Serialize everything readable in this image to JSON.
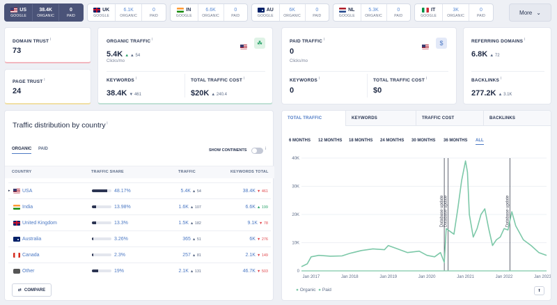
{
  "country_tabs": [
    {
      "code": "US",
      "flag": "f-us",
      "organic": "38.4K",
      "paid": "0",
      "organic_label": "ORGANIC",
      "paid_label": "PAID",
      "engine": "GOOGLE",
      "active": true
    },
    {
      "code": "UK",
      "flag": "f-uk",
      "organic": "6.1K",
      "paid": "0",
      "organic_label": "ORGANIC",
      "paid_label": "PAID",
      "engine": "GOOGLE",
      "active": false
    },
    {
      "code": "IN",
      "flag": "f-in",
      "organic": "6.6K",
      "paid": "0",
      "organic_label": "ORGANIC",
      "paid_label": "PAID",
      "engine": "GOOGLE",
      "active": false
    },
    {
      "code": "AU",
      "flag": "f-au",
      "organic": "6K",
      "paid": "0",
      "organic_label": "ORGANIC",
      "paid_label": "PAID",
      "engine": "GOOGLE",
      "active": false
    },
    {
      "code": "NL",
      "flag": "f-nl",
      "organic": "5.3K",
      "paid": "0",
      "organic_label": "ORGANIC",
      "paid_label": "PAID",
      "engine": "GOOGLE",
      "active": false
    },
    {
      "code": "IT",
      "flag": "f-it",
      "organic": "3K",
      "paid": "0",
      "organic_label": "ORGANIC",
      "paid_label": "PAID",
      "engine": "GOOGLE",
      "active": false
    }
  ],
  "more_label": "More",
  "domain_trust": {
    "label": "DOMAIN TRUST",
    "value": "73"
  },
  "page_trust": {
    "label": "PAGE TRUST",
    "value": "24"
  },
  "organic": {
    "label": "ORGANIC TRAFFIC",
    "value": "5.4K",
    "delta": "▲ 54",
    "unit": "Clicks/mo",
    "kw_label": "KEYWORDS",
    "kw_value": "38.4K",
    "kw_delta": "▼ 461",
    "cost_label": "TOTAL TRAFFIC COST",
    "cost_value": "$20K",
    "cost_delta": "▲ 240.4"
  },
  "paid": {
    "label": "PAID TRAFFIC",
    "value": "0",
    "unit": "Clicks/mo",
    "kw_label": "KEYWORDS",
    "kw_value": "0",
    "cost_label": "TOTAL TRAFFIC COST",
    "cost_value": "$0"
  },
  "referring": {
    "label": "REFERRING DOMAINS",
    "value": "6.8K",
    "delta": "▲ 72",
    "bl_label": "BACKLINKS",
    "bl_value": "277.2K",
    "bl_delta": "▲ 3.1K"
  },
  "distribution": {
    "title": "Traffic distribution by country",
    "tab_organic": "ORGANIC",
    "tab_paid": "PAID",
    "show_continents": "SHOW CONTINENTS",
    "headers": {
      "country": "COUNTRY",
      "share": "TRAFFIC SHARE",
      "traffic": "TRAFFIC",
      "keywords": "KEYWORDS TOTAL"
    },
    "rows": [
      {
        "name": "USA",
        "flag": "f-us",
        "share": "48.17%",
        "pct": 48.17,
        "traffic": "5.4K",
        "t_delta": "▲ 54",
        "t_dir": "up",
        "kw": "38.4K",
        "k_delta": "▼ 461",
        "k_dir": "down"
      },
      {
        "name": "India",
        "flag": "f-in",
        "share": "13.98%",
        "pct": 13.98,
        "traffic": "1.6K",
        "t_delta": "▲ 107",
        "t_dir": "up",
        "kw": "6.6K",
        "k_delta": "▲ 199",
        "k_dir": "up"
      },
      {
        "name": "United Kingdom",
        "flag": "f-uk",
        "share": "13.3%",
        "pct": 13.3,
        "traffic": "1.5K",
        "t_delta": "▲ 182",
        "t_dir": "up",
        "kw": "9.1K",
        "k_delta": "▼ 78",
        "k_dir": "down"
      },
      {
        "name": "Australia",
        "flag": "f-au",
        "share": "3.26%",
        "pct": 3.26,
        "traffic": "365",
        "t_delta": "▲ 51",
        "t_dir": "up",
        "kw": "6K",
        "k_delta": "▼ 276",
        "k_dir": "down"
      },
      {
        "name": "Canada",
        "flag": "f-ca",
        "share": "2.3%",
        "pct": 2.3,
        "traffic": "257",
        "t_delta": "▲ 81",
        "t_dir": "up",
        "kw": "2.1K",
        "k_delta": "▼ 149",
        "k_dir": "down"
      },
      {
        "name": "Other",
        "flag": "f-ot",
        "share": "19%",
        "pct": 19,
        "traffic": "2.1K",
        "t_delta": "▲ 131",
        "t_dir": "up",
        "kw": "46.7K",
        "k_delta": "▼ 503",
        "k_dir": "down"
      }
    ],
    "compare_label": "COMPARE"
  },
  "chart_tabs": [
    "TOTAL TRAFFIC",
    "KEYWORDS",
    "TRAFFIC COST",
    "BACKLINKS"
  ],
  "periods": [
    "6 MONTHS",
    "12 MONTHS",
    "18 MONTHS",
    "24 MONTHS",
    "30 MONTHS",
    "36 MONTHS",
    "ALL"
  ],
  "chart_data": {
    "type": "line",
    "y_ticks": [
      "0",
      "10K",
      "20K",
      "30K",
      "40K"
    ],
    "ylim": [
      0,
      40000
    ],
    "x_ticks": [
      "Jan 2017",
      "Jan 2018",
      "Jan 2019",
      "Jan 2020",
      "Jan 2021",
      "Jan 2022",
      "Jan 2023"
    ],
    "x_range": [
      2016.75,
      2023.1
    ],
    "annotations": [
      {
        "x": 2020.45,
        "label": "Database update"
      },
      {
        "x": 2020.55,
        "label": "Database update"
      },
      {
        "x": 2022.15,
        "label": "Database update"
      }
    ],
    "series": [
      {
        "name": "Organic",
        "color": "#7cc8a8",
        "x": [
          2016.75,
          2016.9,
          2017.0,
          2017.2,
          2017.5,
          2017.8,
          2018.0,
          2018.3,
          2018.6,
          2018.9,
          2019.0,
          2019.2,
          2019.5,
          2019.8,
          2020.0,
          2020.2,
          2020.35,
          2020.45,
          2020.5,
          2020.6,
          2020.7,
          2020.8,
          2020.9,
          2021.0,
          2021.05,
          2021.1,
          2021.2,
          2021.3,
          2021.4,
          2021.5,
          2021.6,
          2021.7,
          2021.8,
          2021.9,
          2022.0,
          2022.1,
          2022.2,
          2022.3,
          2022.5,
          2022.7,
          2022.9,
          2023.1
        ],
        "y": [
          1500,
          2500,
          5000,
          5500,
          5200,
          5300,
          6200,
          7200,
          7800,
          7500,
          9000,
          8000,
          6500,
          7000,
          5500,
          5000,
          6500,
          3000,
          15000,
          14000,
          13000,
          22000,
          32000,
          39000,
          35000,
          20000,
          12000,
          15000,
          20000,
          22000,
          15000,
          9000,
          11000,
          12000,
          15000,
          14500,
          21000,
          16000,
          11000,
          9000,
          6500,
          5500
        ]
      },
      {
        "name": "Paid",
        "color": "#7cc8a8",
        "x": [
          2016.75,
          2023.1
        ],
        "y": [
          0,
          0
        ]
      }
    ]
  }
}
